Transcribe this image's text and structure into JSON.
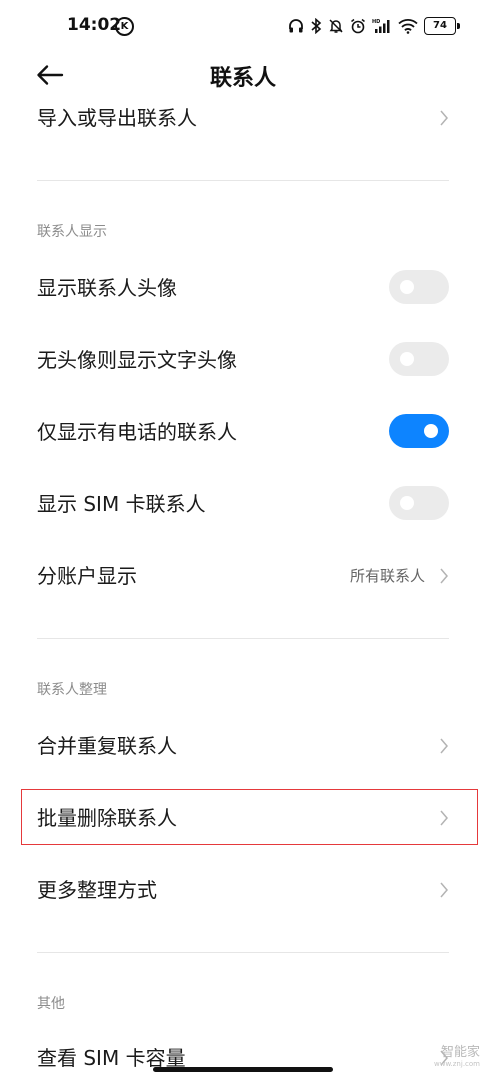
{
  "status_bar": {
    "time": "14:02",
    "k_badge": "K",
    "battery": "74",
    "icons": [
      "headphones-icon",
      "bluetooth-icon",
      "mute-icon",
      "alarm-icon",
      "signal-icon",
      "wifi-icon",
      "battery-icon"
    ]
  },
  "header": {
    "title": "联系人",
    "back_icon": "back-arrow-icon"
  },
  "top_item": {
    "label": "导入或导出联系人"
  },
  "display_section": {
    "header": "联系人显示",
    "items": [
      {
        "label": "显示联系人头像",
        "toggle": false
      },
      {
        "label": "无头像则显示文字头像",
        "toggle": false
      },
      {
        "label": "仅显示有电话的联系人",
        "toggle": true
      },
      {
        "label": "显示 SIM 卡联系人",
        "toggle": false
      }
    ],
    "account_item": {
      "label": "分账户显示",
      "value": "所有联系人"
    }
  },
  "organize_section": {
    "header": "联系人整理",
    "items": [
      {
        "label": "合并重复联系人"
      },
      {
        "label": "批量删除联系人",
        "highlighted": true
      },
      {
        "label": "更多整理方式"
      }
    ]
  },
  "other_section": {
    "header": "其他",
    "items": [
      {
        "label": "查看 SIM 卡容量"
      }
    ]
  },
  "watermark": {
    "main": "智能家",
    "sub": "www.znj.com"
  },
  "colors": {
    "accent": "#0d84ff",
    "toggle_off": "#ebebeb",
    "highlight": "#e5393b",
    "section_header": "#8c8c8c"
  }
}
